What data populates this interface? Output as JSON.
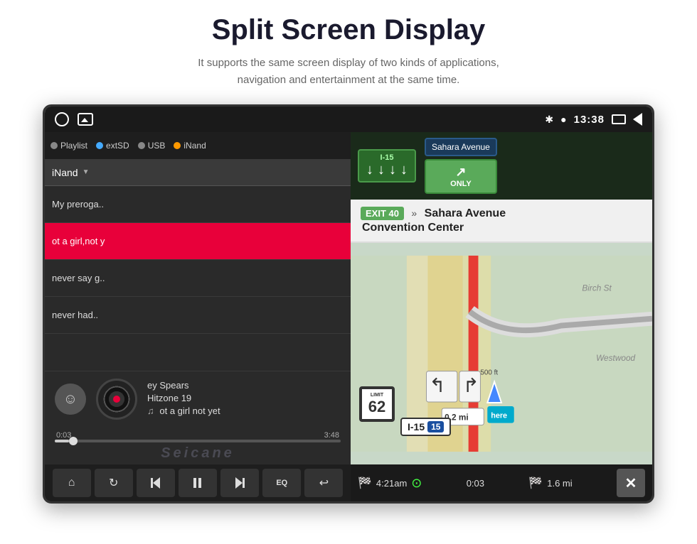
{
  "header": {
    "title": "Split Screen Display",
    "subtitle_line1": "It supports the same screen display of two kinds of applications,",
    "subtitle_line2": "navigation and entertainment at the same time."
  },
  "status_bar": {
    "time": "13:38",
    "bluetooth_icon": "bluetooth",
    "location_icon": "location-pin"
  },
  "music": {
    "source": "iNand",
    "source_options": [
      "Playlist",
      "extSD",
      "USB",
      "iNand"
    ],
    "songs": [
      {
        "title": "My preroga..",
        "active": false
      },
      {
        "title": "ot a girl,not y",
        "active": true
      },
      {
        "title": "never say g..",
        "active": false
      },
      {
        "title": "never had..",
        "active": false
      }
    ],
    "now_playing": {
      "artist": "ey Spears",
      "album": "Hitzone 19",
      "song": "ot a girl not yet"
    },
    "progress": {
      "current": "0:03",
      "total": "3:48"
    },
    "controls": [
      "home",
      "repeat",
      "prev",
      "pause",
      "next",
      "eq",
      "return"
    ]
  },
  "navigation": {
    "signs": {
      "highway": "I-15",
      "arrows": [
        "↓",
        "↓",
        "↓",
        "↓"
      ],
      "only": "ONLY"
    },
    "exit": {
      "number": "EXIT 40",
      "destination": "Sahara Avenue",
      "subdestination": "Convention Center"
    },
    "speed_limit": "62",
    "route": "I-15",
    "route_badge": "15",
    "bottom": {
      "arrival": "4:21am",
      "time_remaining": "0:03",
      "distance": "1.6 mi"
    }
  },
  "watermark": "Seicane"
}
